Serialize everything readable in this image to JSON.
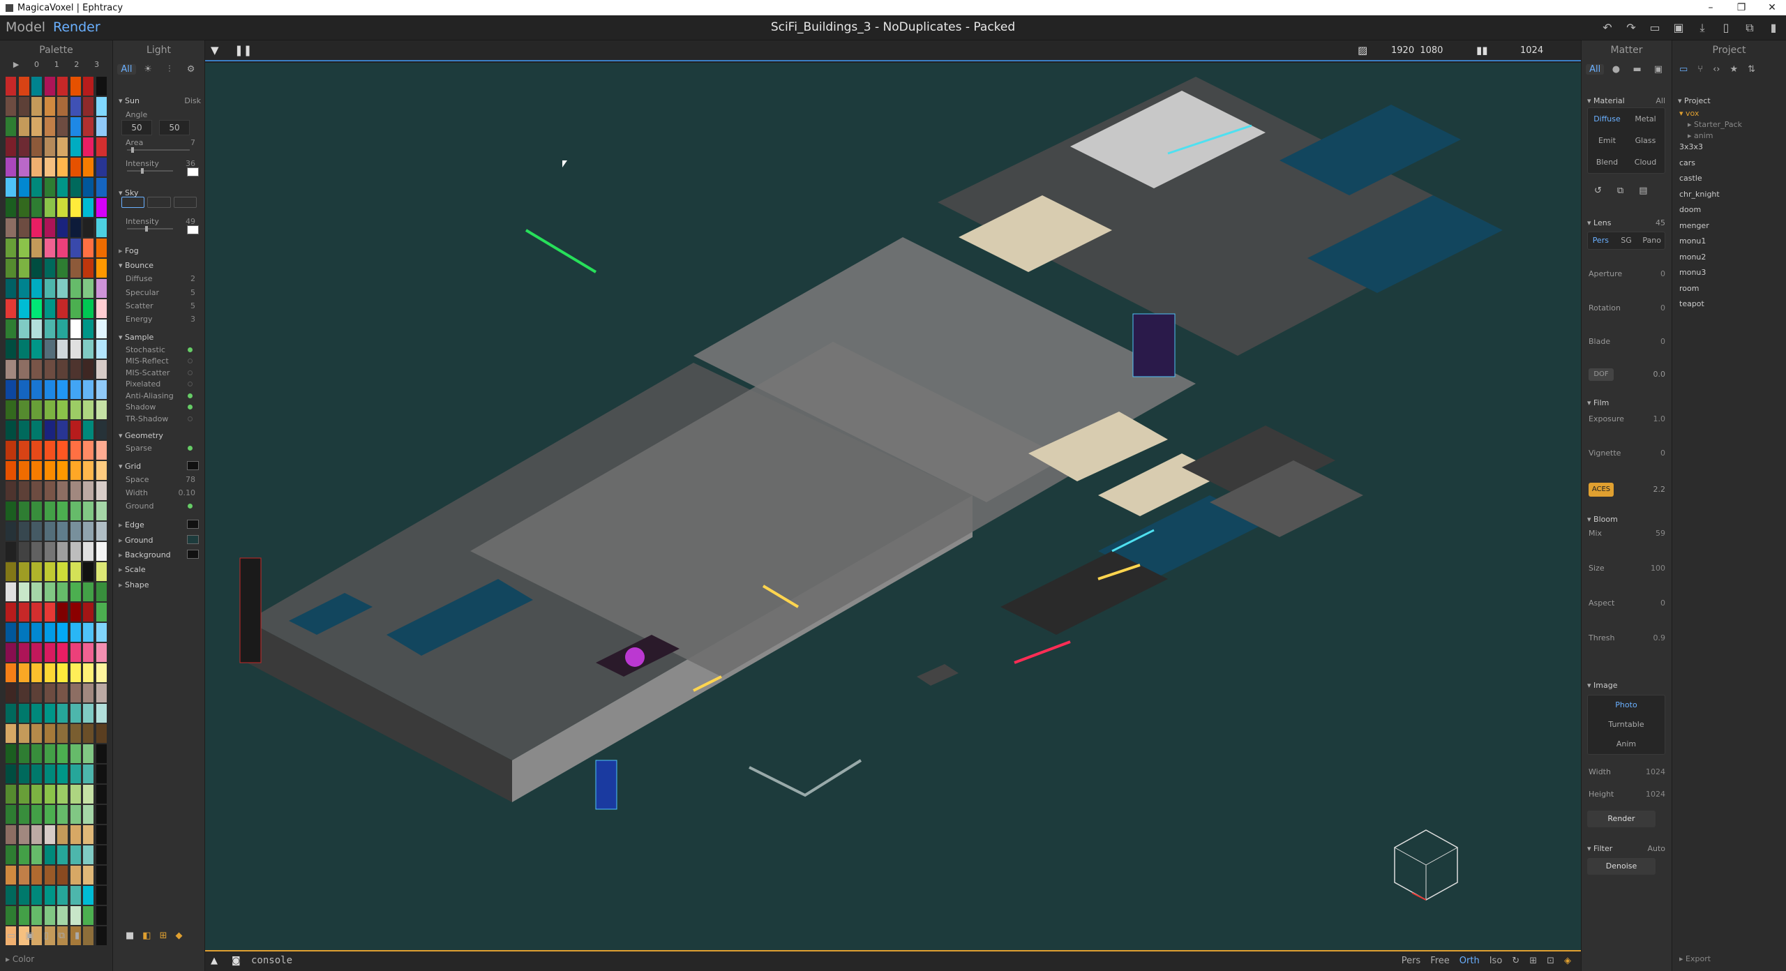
{
  "window": {
    "title": "MagicaVoxel | Ephtracy",
    "controls": [
      "–",
      "❐",
      "✕"
    ]
  },
  "menubar": {
    "model": "Model",
    "render": "Render",
    "doc_title": "SciFi_Buildings_3 - NoDuplicates - Packed"
  },
  "palette": {
    "title": "Palette",
    "header": [
      "▶",
      "0",
      "1",
      "2",
      "3"
    ],
    "footer_label": "Color",
    "colors": [
      [
        "#c62828",
        "#d84315",
        "#00838f",
        "#ad1457",
        "#c62828",
        "#e65100",
        "#b71c1c",
        "#111111"
      ],
      [
        "#6d4c41",
        "#5d4037",
        "#c49a5a",
        "#d08a40",
        "#aa6a3a",
        "#3f51b5",
        "#8e2a2a",
        "#80d8ff"
      ],
      [
        "#2e7d32",
        "#c49a5a",
        "#d7a865",
        "#c17f48",
        "#6d4c41",
        "#1e88e5",
        "#b13030",
        "#90caf9"
      ],
      [
        "#7b1f2a",
        "#6d2a33",
        "#8d5a3a",
        "#b58a5a",
        "#d7a865",
        "#00acc1",
        "#e91e63",
        "#d32f2f"
      ],
      [
        "#ab47bc",
        "#ba68c8",
        "#f0b070",
        "#f5c080",
        "#ffb74d",
        "#e65100",
        "#f57c00",
        "#283593"
      ],
      [
        "#4fc3f7",
        "#0288d1",
        "#00897b",
        "#2e7d32",
        "#009688",
        "#00695c",
        "#01579b",
        "#1565c0"
      ],
      [
        "#1b5e20",
        "#33691e",
        "#2e7d32",
        "#8bc34a",
        "#cddc39",
        "#ffeb3b",
        "#00bcd4",
        "#d500f9"
      ],
      [
        "#8d6e63",
        "#6d4c41",
        "#e91e63",
        "#ad1457",
        "#1a237e",
        "#0d1b3a",
        "#212121",
        "#4dd0e1"
      ],
      [
        "#689f38",
        "#8bc34a",
        "#c49a5a",
        "#f06292",
        "#ec407a",
        "#3949ab",
        "#ff7043",
        "#ef6c00"
      ],
      [
        "#558b2f",
        "#7cb342",
        "#004d40",
        "#00695c",
        "#2e7d32",
        "#8d5a3a",
        "#bf360c",
        "#ff9800"
      ],
      [
        "#006064",
        "#00838f",
        "#00acc1",
        "#4db6ac",
        "#80cbc4",
        "#66bb6a",
        "#81c784",
        "#ce93d8"
      ],
      [
        "#e53935",
        "#00bcd4",
        "#00e676",
        "#009688",
        "#c62828",
        "#4caf50",
        "#00c853",
        "#ffcdd2"
      ],
      [
        "#2e7d32",
        "#80cbc4",
        "#b2dfdb",
        "#4db6ac",
        "#26a69a",
        "#ffffff",
        "#009688",
        "#e1f5fe"
      ],
      [
        "#004d40",
        "#00796b",
        "#009688",
        "#546e7a",
        "#cfd8dc",
        "#e0e0e0",
        "#80cbc4",
        "#b3e5fc"
      ],
      [
        "#a1887f",
        "#8d6e63",
        "#795548",
        "#6d4c41",
        "#5d4037",
        "#4e342e",
        "#3e2723",
        "#d7ccc8"
      ],
      [
        "#0d47a1",
        "#1565c0",
        "#1976d2",
        "#1e88e5",
        "#2196f3",
        "#42a5f5",
        "#64b5f6",
        "#90caf9"
      ],
      [
        "#33691e",
        "#558b2f",
        "#689f38",
        "#7cb342",
        "#8bc34a",
        "#9ccc65",
        "#aed581",
        "#c5e1a5"
      ],
      [
        "#004d40",
        "#00695c",
        "#00796b",
        "#1a237e",
        "#283593",
        "#b71c1c",
        "#00897b",
        "#263238"
      ],
      [
        "#bf360c",
        "#d84315",
        "#e64a19",
        "#f4511e",
        "#ff5722",
        "#ff7043",
        "#ff8a65",
        "#ffab91"
      ],
      [
        "#e65100",
        "#ef6c00",
        "#f57c00",
        "#fb8c00",
        "#ff9800",
        "#ffa726",
        "#ffb74d",
        "#ffcc80"
      ],
      [
        "#4e342e",
        "#5d4037",
        "#6d4c41",
        "#795548",
        "#8d6e63",
        "#a1887f",
        "#bcaaa4",
        "#d7ccc8"
      ],
      [
        "#1b5e20",
        "#2e7d32",
        "#388e3c",
        "#43a047",
        "#4caf50",
        "#66bb6a",
        "#81c784",
        "#a5d6a7"
      ],
      [
        "#263238",
        "#37474f",
        "#455a64",
        "#546e7a",
        "#607d8b",
        "#78909c",
        "#90a4ae",
        "#b0bec5"
      ],
      [
        "#212121",
        "#424242",
        "#616161",
        "#757575",
        "#9e9e9e",
        "#bdbdbd",
        "#e0e0e0",
        "#f5f5f5"
      ],
      [
        "#827717",
        "#9e9d24",
        "#afb42b",
        "#c0ca33",
        "#cddc39",
        "#d4e157",
        "#111111",
        "#dce775"
      ],
      [
        "#e0e0e0",
        "#c8e6c9",
        "#a5d6a7",
        "#81c784",
        "#66bb6a",
        "#4caf50",
        "#43a047",
        "#388e3c"
      ],
      [
        "#b71c1c",
        "#c62828",
        "#d32f2f",
        "#e53935",
        "#7f0000",
        "#8b0000",
        "#a31515",
        "#4caf50"
      ],
      [
        "#01579b",
        "#0277bd",
        "#0288d1",
        "#039be5",
        "#03a9f4",
        "#29b6f6",
        "#4fc3f7",
        "#81d4fa"
      ],
      [
        "#880e4f",
        "#ad1457",
        "#c2185b",
        "#d81b60",
        "#e91e63",
        "#ec407a",
        "#f06292",
        "#f48fb1"
      ],
      [
        "#f57f17",
        "#f9a825",
        "#fbc02d",
        "#fdd835",
        "#ffeb3b",
        "#ffee58",
        "#fff176",
        "#fff59d"
      ],
      [
        "#3e2723",
        "#4e342e",
        "#5d4037",
        "#6d4c41",
        "#795548",
        "#8d6e63",
        "#a1887f",
        "#bcaaa4"
      ],
      [
        "#00695c",
        "#00796b",
        "#00897b",
        "#009688",
        "#26a69a",
        "#4db6ac",
        "#80cbc4",
        "#b2dfdb"
      ],
      [
        "#d7a865",
        "#c49a5a",
        "#b58a4a",
        "#a67a3a",
        "#8d6e3a",
        "#7a5e30",
        "#6a4e28",
        "#5a3e20"
      ],
      [
        "#1b5e20",
        "#2e7d32",
        "#388e3c",
        "#43a047",
        "#4caf50",
        "#66bb6a",
        "#81c784",
        "#111111"
      ],
      [
        "#004d40",
        "#00695c",
        "#00796b",
        "#00897b",
        "#009688",
        "#26a69a",
        "#4db6ac",
        "#111111"
      ],
      [
        "#558b2f",
        "#689f38",
        "#7cb342",
        "#8bc34a",
        "#9ccc65",
        "#aed581",
        "#c5e1a5",
        "#111111"
      ],
      [
        "#2e7d32",
        "#388e3c",
        "#43a047",
        "#4caf50",
        "#66bb6a",
        "#81c784",
        "#a5d6a7",
        "#111111"
      ],
      [
        "#8d6e63",
        "#a1887f",
        "#bcaaa4",
        "#d7ccc8",
        "#c49a5a",
        "#d7a865",
        "#e0b878",
        "#111111"
      ],
      [
        "#2e7d32",
        "#43a047",
        "#66bb6a",
        "#00897b",
        "#26a69a",
        "#4db6ac",
        "#80cbc4",
        "#111111"
      ],
      [
        "#d08a40",
        "#c17f48",
        "#b06a30",
        "#9a5a28",
        "#8a4a20",
        "#d7a865",
        "#e0b878",
        "#111111"
      ],
      [
        "#00695c",
        "#00796b",
        "#00897b",
        "#009688",
        "#26a69a",
        "#4db6ac",
        "#00bcd4",
        "#111111"
      ],
      [
        "#2e7d32",
        "#43a047",
        "#66bb6a",
        "#81c784",
        "#a5d6a7",
        "#c8e6c9",
        "#4caf50",
        "#111111"
      ],
      [
        "#f0b070",
        "#f5c080",
        "#d7a865",
        "#c49a5a",
        "#b58a4a",
        "#a67a3a",
        "#8d6e3a",
        "#111111"
      ]
    ]
  },
  "light": {
    "title": "Light",
    "tabs": [
      "All",
      "☀",
      "⫶",
      "⚙"
    ],
    "sun": {
      "label": "Sun",
      "mode": "Disk",
      "angle_label": "Angle",
      "angle_a": "50",
      "angle_b": "50",
      "area_label": "Area",
      "area": "7",
      "intensity_label": "Intensity",
      "intensity": "36"
    },
    "sky": {
      "label": "Sky",
      "intensity_label": "Intensity",
      "intensity": "49"
    },
    "fog": "Fog",
    "bounce": {
      "label": "Bounce",
      "items": [
        [
          "Diffuse",
          "2"
        ],
        [
          "Specular",
          "5"
        ],
        [
          "Scatter",
          "5"
        ],
        [
          "Energy",
          "3"
        ]
      ]
    },
    "sample": {
      "label": "Sample",
      "items": [
        [
          "Stochastic",
          true
        ],
        [
          "MIS-Reflect",
          false
        ],
        [
          "MIS-Scatter",
          false
        ],
        [
          "Pixelated",
          false
        ],
        [
          "Anti-Aliasing",
          true
        ],
        [
          "Shadow",
          true
        ],
        [
          "TR-Shadow",
          false
        ]
      ]
    },
    "geometry": {
      "label": "Geometry",
      "sparse": "Sparse"
    },
    "grid": {
      "label": "Grid",
      "space_label": "Space",
      "space": "78",
      "width_label": "Width",
      "width": "0.10",
      "ground_label": "Ground"
    },
    "collapsed": [
      "Edge",
      "Ground",
      "Background",
      "Scale",
      "Shape"
    ]
  },
  "viewport": {
    "res_w": "1920",
    "res_h": "1080",
    "samples": "1024",
    "console": "console",
    "viewmodes": [
      "Pers",
      "Free",
      "Orth",
      "Iso"
    ],
    "active_viewmode": "Orth",
    "scene_bg": "#1d3b3c"
  },
  "matter": {
    "title": "Matter",
    "tabs": [
      "All",
      "●",
      "▬",
      "▣"
    ],
    "material": {
      "label": "Material",
      "scope": "All",
      "types": [
        "Diffuse",
        "Metal",
        "Emit",
        "Glass",
        "Blend",
        "Cloud"
      ],
      "active": "Diffuse"
    },
    "lens": {
      "label": "Lens",
      "fov": "45",
      "modes": [
        "Pers",
        "SG",
        "Pano"
      ],
      "active": "Pers",
      "props": [
        [
          "Aperture",
          "0"
        ],
        [
          "Rotation",
          "0"
        ],
        [
          "Blade",
          "0"
        ]
      ],
      "dof": "DOF",
      "dof_val": "0.0"
    },
    "film": {
      "label": "Film",
      "props": [
        [
          "Exposure",
          "1.0"
        ],
        [
          "Vignette",
          "0"
        ]
      ],
      "aces": "ACES",
      "gamma": "2.2"
    },
    "bloom": {
      "label": "Bloom",
      "props": [
        [
          "Mix",
          "59"
        ],
        [
          "Size",
          "100"
        ],
        [
          "Aspect",
          "0"
        ],
        [
          "Thresh",
          "0.9"
        ]
      ]
    },
    "image": {
      "label": "Image",
      "modes": [
        "Photo",
        "Turntable",
        "Anim"
      ],
      "active": "Photo",
      "width_label": "Width",
      "width": "1024",
      "height_label": "Height",
      "height": "1024",
      "render": "Render"
    },
    "filter": {
      "label": "Filter",
      "mode": "Auto",
      "denoise": "Denoise"
    }
  },
  "project": {
    "title": "Project",
    "root": "Project",
    "folder": "vox",
    "subfolders": [
      "Starter_Pack",
      "anim"
    ],
    "files": [
      "3x3x3",
      "cars",
      "castle",
      "chr_knight",
      "doom",
      "menger",
      "monu1",
      "monu2",
      "monu3",
      "room",
      "teapot"
    ],
    "export": "Export"
  },
  "colors": {
    "accent": "#6ab0ff",
    "aces": "#e0a030",
    "panel": "#2c2c2c"
  }
}
